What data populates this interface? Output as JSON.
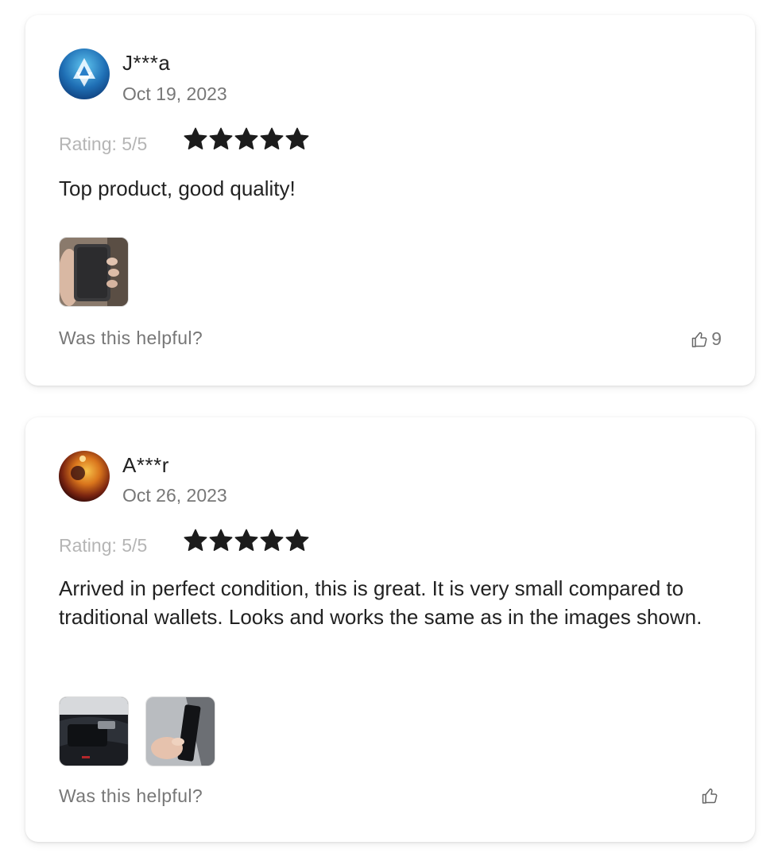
{
  "reviews": [
    {
      "author": "J***a",
      "date": "Oct 19, 2023",
      "rating_label": "Rating: 5/5",
      "rating": 5,
      "text": "Top product, good quality!",
      "photo_count": 1,
      "helpful_label": "Was this helpful?",
      "like_count": "9"
    },
    {
      "author": "A***r",
      "date": "Oct 26, 2023",
      "rating_label": "Rating: 5/5",
      "rating": 5,
      "text": "Arrived in perfect condition, this is great. It is very small compared to traditional wallets. Looks and works the same as in the images shown.",
      "photo_count": 2,
      "helpful_label": "Was this helpful?",
      "like_count": ""
    }
  ],
  "icons": {
    "star": "star-icon",
    "like": "thumbs-up-icon"
  },
  "colors": {
    "star": "#1c1c1c",
    "muted_text": "#777777",
    "rating_label": "#b5b5b5"
  }
}
